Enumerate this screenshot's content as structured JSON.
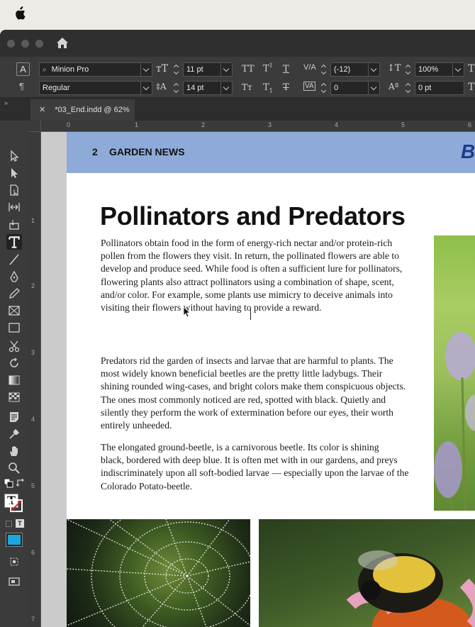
{
  "document": {
    "tab_title": "*03_End.indd @ 62%"
  },
  "control_panel": {
    "font_family": "Minion Pro",
    "font_style": "Regular",
    "font_size": "11 pt",
    "leading": "14 pt",
    "kerning": "(-12)",
    "tracking": "0",
    "vertical_scale": "100%",
    "baseline_shift": "0 pt"
  },
  "rulers": {
    "horizontal": [
      "0",
      "1",
      "2",
      "3",
      "4",
      "5",
      "6"
    ],
    "vertical": [
      "1",
      "2",
      "3",
      "4",
      "5",
      "6",
      "7"
    ]
  },
  "page": {
    "page_number": "2",
    "section": "GARDEN NEWS",
    "brand_partial": "B",
    "headline": "Pollinators and Predators",
    "paragraphs": [
      [
        "Pollinators obtain food in the form of energy-rich nectar and/or protein-rich",
        "pollen from the flowers they visit. In return, the pollinated flowers are able to",
        "develop and produce seed. While food is often a sufficient lure for pollinators,",
        "flowering plants also attract pollinators using a combination of shape, scent,",
        "and/or color. For example, some plants use mimicry to deceive animals into",
        "visiting their flowers without having to provide a reward."
      ],
      [
        "Predators rid the garden of insects and larvae that are harmful to plants. The",
        "most widely known beneficial beetles are the pretty little ladybugs. Their",
        "shining rounded wing-cases, and bright colors make them conspicuous objects.",
        "The ones most commonly noticed are red, spotted with black. Quietly and",
        "silently they perform the work of extermination before our eyes, their worth",
        "entirely unheeded."
      ],
      [
        "The elongated ground-beetle, is a carnivorous beetle. Its color is shining",
        "black, bordered with deep blue. It is often met with in our gardens, and preys",
        "indiscriminately upon all soft-bodied larvae — especially upon the larvae of the",
        "Colorado Potato-beetle."
      ]
    ]
  },
  "colors": {
    "header_band": "#8eaad8",
    "brand_blue": "#1b3d8a",
    "fill_swatch": "#1aa7e0"
  }
}
